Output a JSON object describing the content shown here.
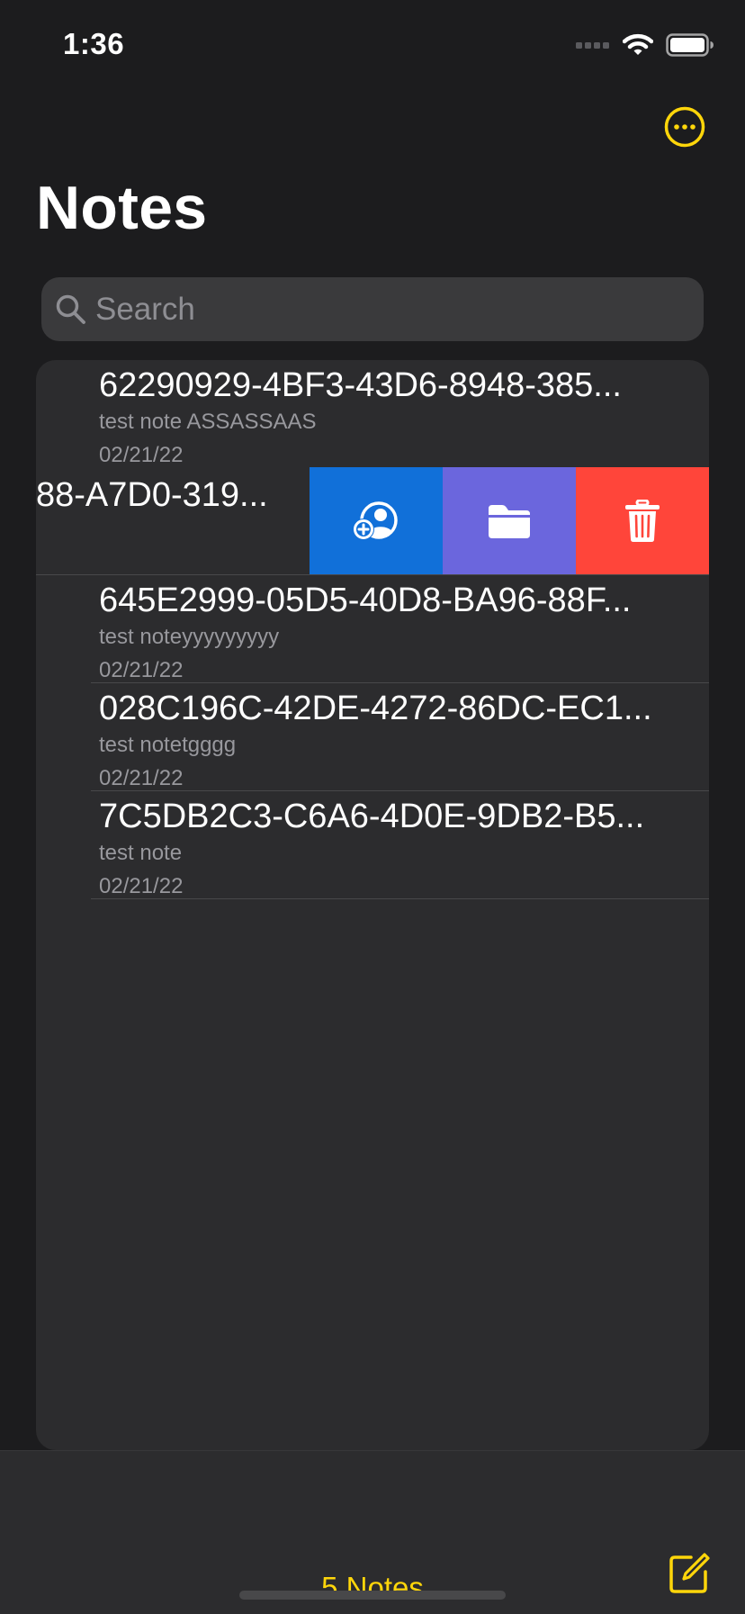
{
  "status_bar": {
    "time": "1:36"
  },
  "header": {
    "title": "Notes",
    "more_icon": "ellipsis-circle-icon"
  },
  "search": {
    "placeholder": "Search",
    "value": ""
  },
  "notes": [
    {
      "title": "62290929-4BF3-43D6-8948-385...",
      "snippet": "test note ASSASSAAS",
      "date": "02/21/22"
    },
    {
      "title": "88-A7D0-319...",
      "swiped": true
    },
    {
      "title": "645E2999-05D5-40D8-BA96-88F...",
      "snippet": "test noteyyyyyyyyy",
      "date": "02/21/22"
    },
    {
      "title": "028C196C-42DE-4272-86DC-EC1...",
      "snippet": "test notetgggg",
      "date": "02/21/22"
    },
    {
      "title": "7C5DB2C3-C6A6-4D0E-9DB2-B5...",
      "snippet": "test note",
      "date": "02/21/22"
    }
  ],
  "swipe_actions": [
    {
      "icon": "share-person-add-icon",
      "color": "#1170d9"
    },
    {
      "icon": "folder-icon",
      "color": "#6b66dd"
    },
    {
      "icon": "trash-icon",
      "color": "#ff453a"
    }
  ],
  "toolbar": {
    "count_label": "5 Notes",
    "compose_icon": "compose-icon"
  },
  "colors": {
    "accent": "#ffd60a",
    "background": "#1c1c1e",
    "card": "#2c2c2e"
  }
}
